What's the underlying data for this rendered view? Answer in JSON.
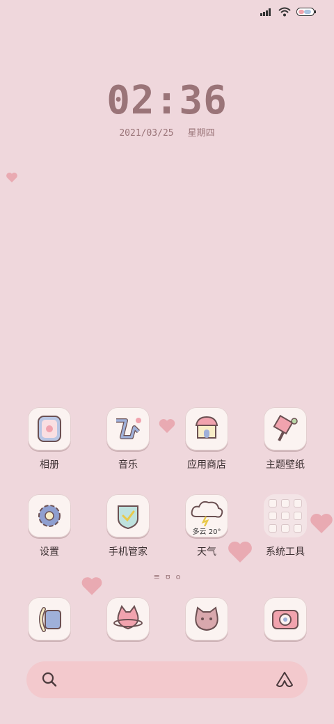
{
  "status_bar": {
    "icons": [
      "signal-icon",
      "wifi-icon",
      "battery-icon"
    ]
  },
  "lockscreen": {
    "time": "02:36",
    "date": "2021/03/25",
    "weekday": "星期四"
  },
  "apps_row1": [
    {
      "label": "相册",
      "icon": "photo-album-icon"
    },
    {
      "label": "音乐",
      "icon": "music-icon"
    },
    {
      "label": "应用商店",
      "icon": "app-store-icon"
    },
    {
      "label": "主题壁纸",
      "icon": "theme-wallpaper-icon"
    }
  ],
  "apps_row2": [
    {
      "label": "设置",
      "icon": "settings-gear-icon"
    },
    {
      "label": "手机管家",
      "icon": "phone-manager-shield-icon"
    },
    {
      "label": "天气",
      "icon": "weather-cloud-icon",
      "weather_text": "多云 20°"
    },
    {
      "label": "系统工具",
      "icon": "system-tools-folder-icon"
    }
  ],
  "page_indicator": [
    "≡",
    "ʊ",
    "o"
  ],
  "dock": [
    "phone-icon",
    "messages-cat-icon",
    "contacts-cat-icon",
    "camera-icon"
  ],
  "colors": {
    "background": "#efd7dc",
    "accent": "#9a7478",
    "tile": "#fbf3f1",
    "search_bar": "#f3c9cd",
    "heart": "#e9aab2"
  }
}
